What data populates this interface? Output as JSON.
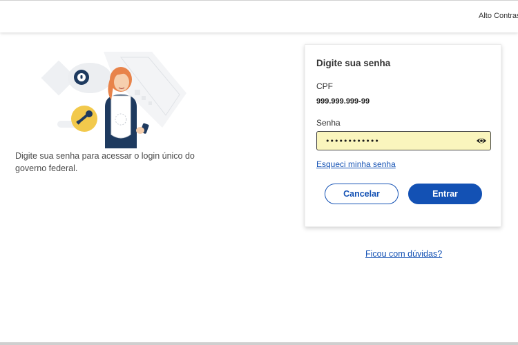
{
  "header": {
    "contrast_label": "Alto Contraste",
    "contrast_icon": "contrast-icon"
  },
  "intro": {
    "text": "Digite sua senha para acessar o login único do governo federal."
  },
  "login_card": {
    "title": "Digite sua senha",
    "cpf_label": "CPF",
    "cpf_value": "999.999.999-99",
    "password_label": "Senha",
    "password_value": "••••••••••••",
    "show_password_icon": "eye-icon",
    "forgot_link": "Esqueci minha senha",
    "cancel_label": "Cancelar",
    "enter_label": "Entrar"
  },
  "footer": {
    "help_link": "Ficou com dúvidas?"
  },
  "colors": {
    "primary": "#1351b4",
    "field_highlight": "#faf5bd",
    "key_badge": "#f2c94c",
    "avatar_hair": "#e8834a"
  }
}
